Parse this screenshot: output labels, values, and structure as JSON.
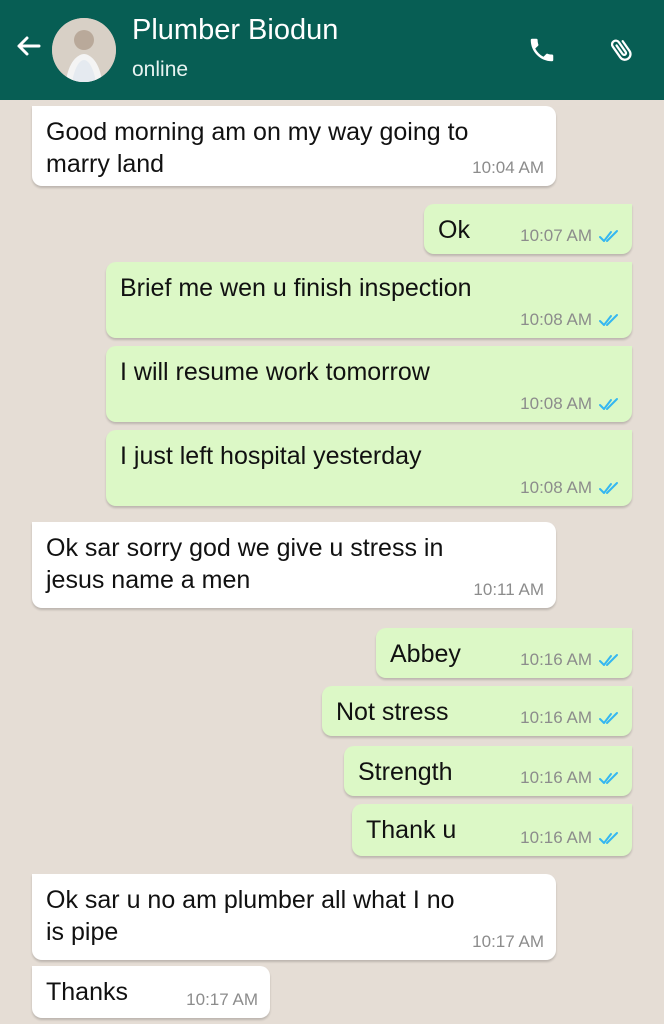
{
  "header": {
    "contact_name": "Plumber Biodun",
    "status": "online"
  },
  "icons": {
    "back": "arrow-left-icon",
    "call": "phone-icon",
    "attach": "paperclip-icon",
    "read": "double-check-icon"
  },
  "messages": [
    {
      "direction": "incoming",
      "text_lines": [
        "Good morning am on my way going to",
        "marry land"
      ],
      "time": "10:04 AM"
    },
    {
      "direction": "outgoing",
      "text_lines": [
        "Ok"
      ],
      "time": "10:07 AM"
    },
    {
      "direction": "outgoing",
      "text_lines": [
        "Brief me wen u finish inspection"
      ],
      "time": "10:08 AM"
    },
    {
      "direction": "outgoing",
      "text_lines": [
        "I will resume work tomorrow"
      ],
      "time": "10:08 AM"
    },
    {
      "direction": "outgoing",
      "text_lines": [
        "I just left hospital yesterday"
      ],
      "time": "10:08 AM"
    },
    {
      "direction": "incoming",
      "text_lines": [
        "Ok sar sorry god we give u stress in",
        "jesus name a men"
      ],
      "time": "10:11 AM"
    },
    {
      "direction": "outgoing",
      "text_lines": [
        "Abbey"
      ],
      "time": "10:16 AM"
    },
    {
      "direction": "outgoing",
      "text_lines": [
        "Not stress"
      ],
      "time": "10:16 AM"
    },
    {
      "direction": "outgoing",
      "text_lines": [
        "Strength"
      ],
      "time": "10:16 AM"
    },
    {
      "direction": "outgoing",
      "text_lines": [
        "Thank u"
      ],
      "time": "10:16 AM"
    },
    {
      "direction": "incoming",
      "text_lines": [
        "Ok sar u no am plumber all what I no",
        "is pipe"
      ],
      "time": "10:17 AM"
    },
    {
      "direction": "incoming",
      "text_lines": [
        "Thanks"
      ],
      "time": "10:17 AM"
    }
  ],
  "colors": {
    "header": "#075e54",
    "incoming_bubble": "#ffffff",
    "outgoing_bubble": "#dcf8c6",
    "chat_background": "#e5ddd5",
    "read_ticks": "#34b7f1"
  }
}
